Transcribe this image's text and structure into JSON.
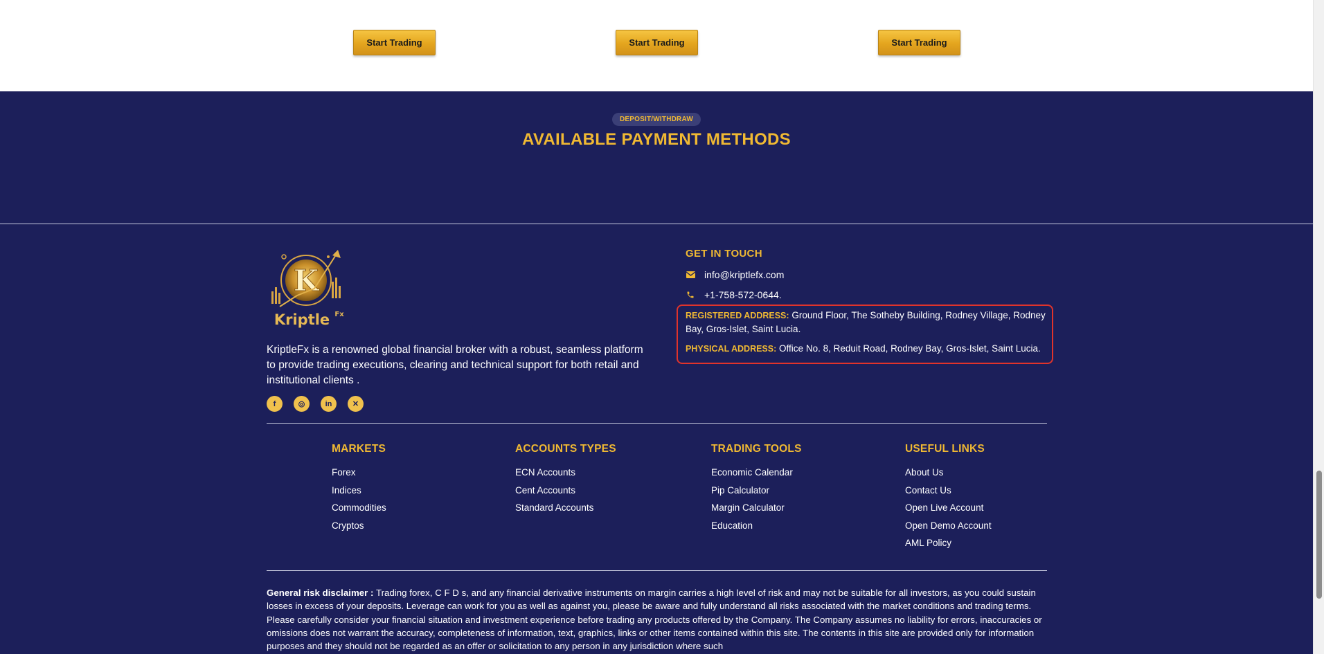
{
  "cta_buttons": [
    "Start Trading",
    "Start Trading",
    "Start Trading"
  ],
  "payments": {
    "pill_label": "DEPOSIT/WITHDRAW",
    "title": "AVAILABLE PAYMENT METHODS"
  },
  "brand": {
    "logo_text": "Kriptle",
    "logo_sup": "Fx",
    "about": "KriptleFx is a renowned global financial broker with a robust, seamless platform to provide trading executions, clearing and technical support for both retail and institutional clients ."
  },
  "socials": [
    {
      "name": "facebook-icon",
      "glyph": "f"
    },
    {
      "name": "instagram-icon",
      "glyph": "◎"
    },
    {
      "name": "linkedin-icon",
      "glyph": "in"
    },
    {
      "name": "x-icon",
      "glyph": "✕"
    }
  ],
  "contact": {
    "title": "GET IN TOUCH",
    "email": "info@kriptlefx.com",
    "phone": "+1-758-572-0644.",
    "registered_label": "REGISTERED ADDRESS:",
    "registered_value": "Ground Floor, The Sotheby Building, Rodney Village, Rodney Bay, Gros-Islet, Saint Lucia.",
    "physical_label": "PHYSICAL ADDRESS:",
    "physical_value": "Office No. 8, Reduit Road, Rodney Bay, Gros-Islet, Saint Lucia."
  },
  "columns": [
    {
      "title": "MARKETS",
      "items": [
        "Forex",
        "Indices",
        "Commodities",
        "Cryptos"
      ]
    },
    {
      "title": "ACCOUNTS TYPES",
      "items": [
        "ECN Accounts",
        "Cent Accounts",
        "Standard Accounts"
      ]
    },
    {
      "title": "TRADING TOOLS",
      "items": [
        "Economic Calendar",
        "Pip Calculator",
        "Margin Calculator",
        "Education"
      ]
    },
    {
      "title": "USEFUL LINKS",
      "items": [
        "About Us",
        "Contact Us",
        "Open Live Account",
        "Open Demo Account",
        "AML Policy"
      ]
    }
  ],
  "disclaimer": {
    "label": "General risk disclaimer :",
    "text": "Trading forex, C F D s, and any financial derivative instruments on margin carries a high level of risk and may not be suitable for all investors, as you could sustain losses in excess of your deposits. Leverage can work for you as well as against you, please be aware and fully understand all risks associated with the market conditions and trading terms. Please carefully consider your financial situation and investment experience before trading any products offered by the Company. The Company assumes no liability for errors, inaccuracies or omissions does not warrant the accuracy, completeness of information, text, graphics, links or other items contained within this site. The contents in this site are provided only for information purposes and they should not be regarded as an offer or solicitation to any person in any jurisdiction where such"
  },
  "colors": {
    "navy": "#1c1f5a",
    "gold": "#f0b933",
    "highlight_border": "#e0332b"
  }
}
